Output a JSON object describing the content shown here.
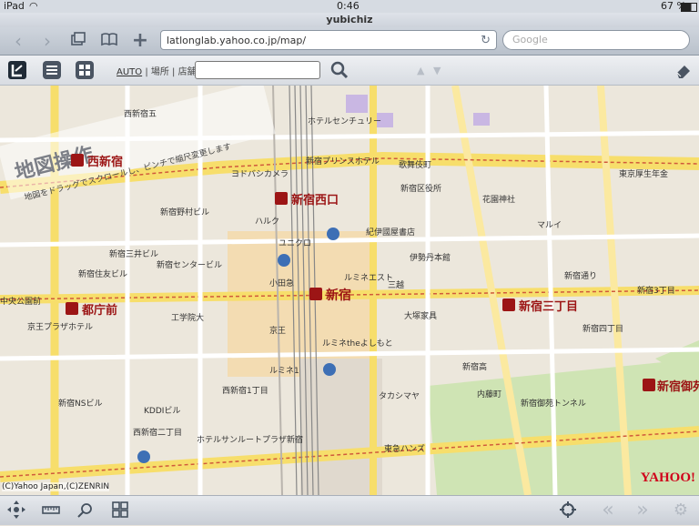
{
  "status_bar": {
    "device": "iPad",
    "time": "0:46",
    "battery": "67 %"
  },
  "browser": {
    "title": "yubichiz",
    "url": "latlonglab.yahoo.co.jp/map/",
    "search_placeholder": "Google"
  },
  "toolbar": {
    "mode_auto": "AUTO",
    "mode_rest": "| 場所 | 店舗",
    "input_value": ""
  },
  "map": {
    "overlay_title": "地図操作",
    "overlay_hint": "地図をドラッグでスクロールし、ピンチで縮尺変更します",
    "logo": "YAHOO!",
    "copyright": "(C)Yahoo Japan,(C)ZENRIN",
    "stations": [
      "新宿西口",
      "新宿",
      "新宿三丁目",
      "都庁前",
      "西新宿",
      "新宿御苑"
    ],
    "labels": {
      "nishi_shinjuku_5": "西新宿五",
      "hotel_century": "ホテルセンチュリー",
      "keio_plaza": "京王プラザホテル",
      "shinjuku_center": "新宿センタービル",
      "mitsui": "新宿三井ビル",
      "sumitomo": "新宿住友ビル",
      "nomura": "新宿野村ビル",
      "shinjuku_nsbldg": "新宿NSビル",
      "kddi": "KDDIビル",
      "odakyu": "小田急",
      "keio": "京王",
      "lumine1": "ルミネ1",
      "lumine2": "ルミネエスト",
      "isetan": "伊勢丹本館",
      "marui": "マルイ",
      "kinokuniya": "紀伊國屋書店",
      "mitsukoshi": "三越",
      "takashimaya": "タカシマヤ",
      "tokyu_hands": "東急ハンズ",
      "hanazono": "花園神社",
      "kabukicho": "歌舞伎町",
      "ward_office": "新宿区役所",
      "prince_hotel": "新宿プリンスホテル",
      "otaki": "大塚家具",
      "gyoen_tunnel": "新宿御苑トンネル",
      "naito": "内藤町",
      "shinjuku_4": "新宿四丁目",
      "nishi_shinjuku_2": "西新宿二丁目",
      "nishi_shinjuku_1": "西新宿1丁目",
      "shinjuku_high": "新宿高",
      "chuo_park": "中央公園前",
      "yodobashi": "ヨドバシカメラ",
      "halc": "ハルク",
      "unicorn": "ユニクロ",
      "rumine_the": "ルミネtheよしもと",
      "shinjuku_3": "新宿3丁目",
      "kogakuin": "工学院大",
      "hotel_sunroute": "ホテルサンルートプラザ新宿",
      "tokyo_koseinenkin": "東京厚生年金",
      "shinjukudori": "新宿通り"
    }
  }
}
